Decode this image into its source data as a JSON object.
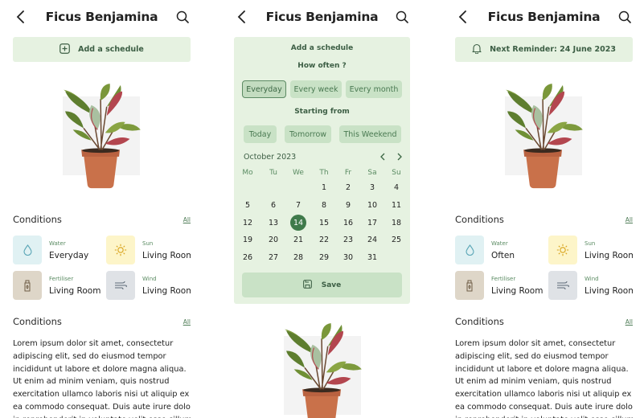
{
  "screen1": {
    "title": "Ficus Benjamina",
    "banner": "Add a schedule",
    "conditions_heading": "Conditions",
    "conditions_all": "All",
    "conditions": [
      {
        "label": "Water",
        "value": "Everyday",
        "icon": "water-drop-icon",
        "color": "#e0f1f3"
      },
      {
        "label": "Sun",
        "value": "Living Room",
        "icon": "sun-icon",
        "color": "#fdf5c9"
      },
      {
        "label": "Fertiliser",
        "value": "Living Room",
        "icon": "fertiliser-icon",
        "color": "#ded6c8"
      },
      {
        "label": "Wind",
        "value": "Living Room",
        "icon": "wind-icon",
        "color": "#dfe2e6"
      }
    ],
    "about_heading": "Conditions",
    "about_all": "All",
    "lorem": "Lorem ipsum dolor sit amet, consectetur adipiscing elit, sed do eiusmod tempor incididunt ut labore et dolore magna aliqua. Ut enim ad minim veniam, quis nostrud exercitation ullamco laboris nisi ut aliquip ex ea commodo consequat. Duis aute irure dolor in reprehenderit in voluptate velit esse cillum dolore eu fugiat nulla pariatur. Excepteur sint"
  },
  "screen2": {
    "title": "Ficus Benjamina",
    "panel_title": "Add a schedule",
    "how_often": "How often ?",
    "frequency": [
      {
        "label": "Everyday",
        "selected": true
      },
      {
        "label": "Every week",
        "selected": false
      },
      {
        "label": "Every month",
        "selected": false
      }
    ],
    "starting_from": "Starting from",
    "start": [
      {
        "label": "Today"
      },
      {
        "label": "Tomorrow"
      },
      {
        "label": "This Weekend"
      }
    ],
    "month": "October 2023",
    "weekdays": [
      "Mo",
      "Tu",
      "We",
      "Th",
      "Fr",
      "Sa",
      "Su"
    ],
    "weeks": [
      [
        "",
        "",
        "",
        "1",
        "2",
        "3",
        "4"
      ],
      [
        "5",
        "6",
        "7",
        "8",
        "9",
        "10",
        "11"
      ],
      [
        "12",
        "13",
        "14",
        "15",
        "16",
        "17",
        "18"
      ],
      [
        "19",
        "20",
        "21",
        "22",
        "23",
        "24",
        "25"
      ],
      [
        "26",
        "27",
        "28",
        "29",
        "30",
        "31",
        ""
      ]
    ],
    "selected_day": "14",
    "save": "Save"
  },
  "screen3": {
    "title": "Ficus Benjamina",
    "banner": "Next Reminder: 24 June 2023",
    "conditions_heading": "Conditions",
    "conditions_all": "All",
    "conditions": [
      {
        "label": "Water",
        "value": "Often",
        "icon": "water-drop-icon",
        "color": "#e0f1f3"
      },
      {
        "label": "Sun",
        "value": "Living Room",
        "icon": "sun-icon",
        "color": "#fdf5c9"
      },
      {
        "label": "Fertiliser",
        "value": "Living Room",
        "icon": "fertiliser-icon",
        "color": "#ded6c8"
      },
      {
        "label": "Wind",
        "value": "Living Room",
        "icon": "wind-icon",
        "color": "#dfe2e6"
      }
    ],
    "about_heading": "Conditions",
    "about_all": "All",
    "lorem": "Lorem ipsum dolor sit amet, consectetur adipiscing elit, sed do eiusmod tempor incididunt ut labore et dolore magna aliqua. Ut enim ad minim veniam, quis nostrud exercitation ullamco laboris nisi ut aliquip ex ea commodo consequat. Duis aute irure dolor in reprehenderit in voluptate velit esse cillum dolore eu fugiat nulla pariatur. Excepteur sint"
  },
  "colors": {
    "accent": "#3f7a4b",
    "panel": "#e6f2e1",
    "chip": "#c9e2c6"
  }
}
